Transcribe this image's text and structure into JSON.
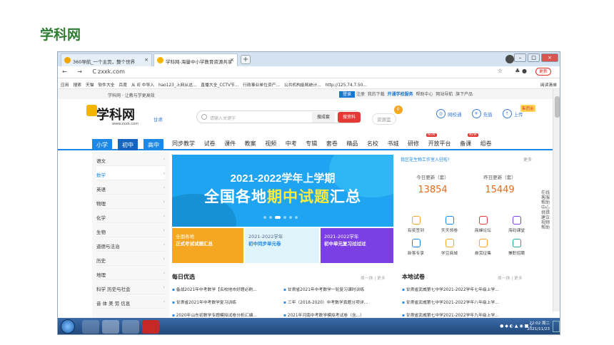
{
  "slide_title": "学科网",
  "browser": {
    "tab1": "360导航_一个主页，整个世界",
    "tab2": "学科网-海量中小学教育资源共享",
    "nav": "← → C",
    "url": "zxxk.com",
    "update_btn": "更新",
    "bookmarks": [
      "应用",
      "搜索",
      "天猫",
      "软件大全",
      "百度",
      "从 IE 中导入",
      "hao123_上网从这...",
      "直播大全_CCTV节...",
      "行政事业单位资产...",
      "公共机构能耗统计...",
      "http://125.74.7.50..."
    ],
    "reading_list": "阅读清单"
  },
  "sitebar": {
    "left": "学科网 · 让教与学更高效",
    "login": "登录",
    "register": "注册",
    "my_download": "我的下载",
    "kaitong": "开通学校服务",
    "help": "帮助中心",
    "nav_map": "网站导航",
    "products": "旗下产品"
  },
  "header": {
    "logo": "学科网",
    "logo_sub": "www.zxxk.com",
    "location": "甘肃",
    "search_placeholder": "请输入关键字",
    "search_set": "搜成套",
    "search_material": "搜资料",
    "basket": "资源篮",
    "basket_count": "0",
    "links": [
      "网校通",
      "充值",
      "上传"
    ],
    "vip": "集团金"
  },
  "nav": {
    "stages": [
      "小学",
      "初中",
      "高中"
    ],
    "items": [
      "同步教学",
      "试卷",
      "课件",
      "教案",
      "视频",
      "中考",
      "专辑",
      "套卷",
      "精品",
      "名校",
      "书城",
      "研修",
      "开放平台",
      "备课",
      "组卷"
    ],
    "hot1": "NEW",
    "hot2": "NEW"
  },
  "sidebar": [
    "语文",
    "数学",
    "英语",
    "物理",
    "化学",
    "生物",
    "道德与法治",
    "历史",
    "地理",
    "科学 历史与社会",
    "音 体 美 劳 信息"
  ],
  "banner": {
    "line1": "2021-2022学年上学期",
    "line2_a": "全国各地",
    "line2_b": "期中试题",
    "line2_c": "汇总"
  },
  "cards": [
    {
      "t1": "全国各地",
      "t2": "正式考试试题汇总"
    },
    {
      "t1": "2021-2022学年",
      "t2": "初中同步单元卷"
    },
    {
      "t1": "2021-2022学年",
      "t2": "初中单元复习过过过"
    }
  ],
  "right": {
    "notice": "我区花生物工作室入驻啦！",
    "more": "更多",
    "today_label": "今日更新（套）",
    "today_val": "13854",
    "yest_label": "昨日更新（套）",
    "yest_val": "15449",
    "grid": [
      "有奖签到",
      "天天领卷",
      "商峰论坛",
      "海码课堂",
      "新客专享",
      "学豆商城",
      "悬赏征集",
      "兼职招聘"
    ]
  },
  "vertical": "在线客服 帮助中心 挑错建议 视频帮助",
  "lists": {
    "daily": "每日优选",
    "local": "本地试卷",
    "more_labels": "换一换 | 更多",
    "daily_rows": [
      "备战2021年中考数学【名校地市好题必刷...",
      "甘肃省2021年中考数学复习训练",
      "2020年山东初数学专题模拟试卷分析汇编..."
    ],
    "mid_rows": [
      "甘肃省2021年中考数学一轮复习课时训练",
      "三年（2018-2020）中考数学真题分项详...",
      "2021年河南中考数学模拟考试卷（含...）"
    ],
    "local_rows": [
      "甘肃省武威第七中学2021-2022学年七年级上学...",
      "甘肃省武威第七中学2021-2022学年八年级上学...",
      "甘肃省武威第七中学2021-2022学年九年级上学..."
    ]
  },
  "taskbar": {
    "time": "22:02 周二",
    "date": "2021/11/23"
  }
}
